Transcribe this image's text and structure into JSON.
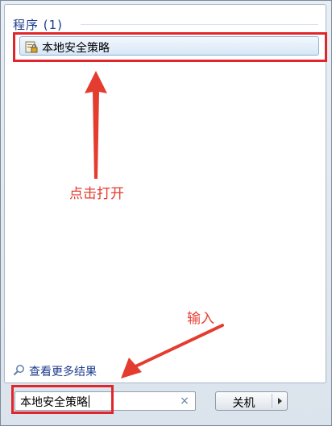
{
  "section": {
    "title": "程序 (1)"
  },
  "results": [
    {
      "label": "本地安全策略",
      "icon": "security-policy-icon"
    }
  ],
  "annotations": {
    "click_to_open": "点击打开",
    "input": "输入"
  },
  "more_results": {
    "label": "查看更多结果",
    "icon": "search-icon"
  },
  "search": {
    "value": "本地安全策略",
    "clear_symbol": "×"
  },
  "shutdown": {
    "label": "关机",
    "arrow_icon": "triangle-right-icon"
  },
  "colors": {
    "annotation_red": "#e43c2f",
    "link_blue": "#1e3b8c"
  }
}
